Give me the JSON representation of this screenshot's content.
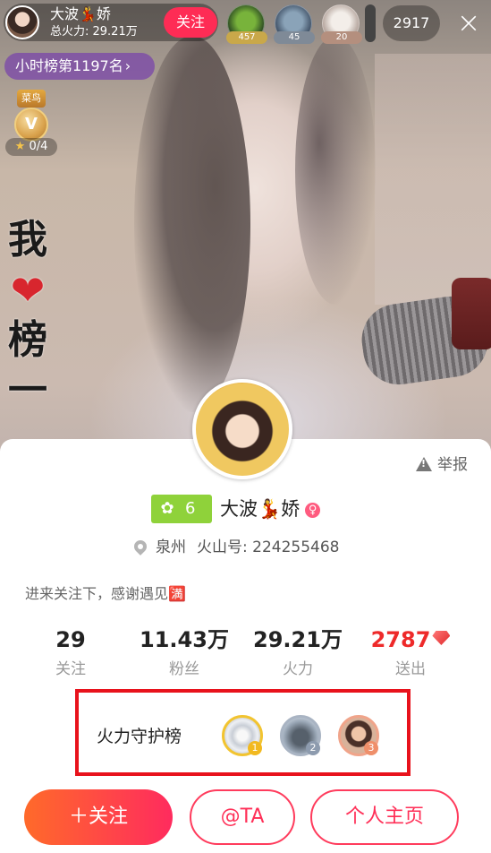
{
  "host": {
    "name": "大波💃娇",
    "total_fire": "总火力: 29.21万",
    "follow_label": "关注"
  },
  "viewers": {
    "badges": [
      "457",
      "45",
      "20"
    ],
    "count": "2917",
    "close_icon": "×"
  },
  "hourly_rank": {
    "label": "小时榜第1197名",
    "chevron": "›"
  },
  "medal": {
    "ribbon": "菜鸟",
    "letter": "V",
    "progress": "0/4",
    "star": "★"
  },
  "side_text": {
    "line1": "我",
    "heart": "❤",
    "line3": "榜",
    "line4": "一"
  },
  "profile": {
    "report_label": "举报",
    "level": "6",
    "level_icon": "sprout-icon",
    "name": "大波💃娇",
    "gender_symbol": "♀",
    "city": "泉州",
    "id": "火山号: 224255468",
    "bio": "进来关注下，感谢遇见🈵",
    "stats": [
      {
        "value": "29",
        "label": "关注"
      },
      {
        "value": "11.43万",
        "label": "粉丝"
      },
      {
        "value": "29.21万",
        "label": "火力"
      },
      {
        "value": "2787",
        "label": "送出"
      }
    ],
    "guard": {
      "title": "火力守护榜",
      "ranks": [
        "1",
        "2",
        "3"
      ]
    }
  },
  "buttons": {
    "follow": "＋关注",
    "at": "@TA",
    "home": "个人主页"
  },
  "colors": {
    "accent": "#fe2c55",
    "gift_value": "#ee2a2a",
    "level_green": "#8fd23a",
    "highlight_box": "#e8121c"
  }
}
